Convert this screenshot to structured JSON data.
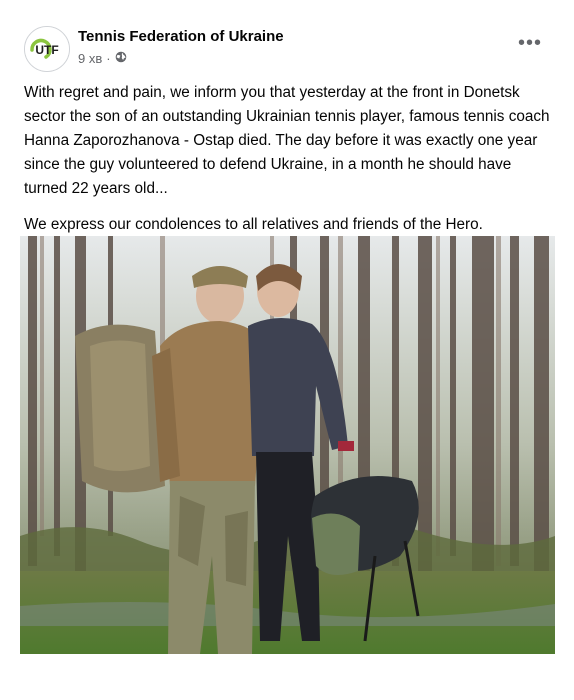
{
  "post": {
    "page_name": "Tennis Federation of Ukraine",
    "avatar_text": "UTF",
    "time": "9 хв",
    "separator": "·",
    "visibility_icon": "globe-icon",
    "more_icon": "more-options-icon",
    "more_label": "•••",
    "paragraphs": [
      "With regret and pain, we inform you that yesterday at the front in Donetsk sector the son of an outstanding Ukrainian tennis player, famous tennis coach Hanna Zaporozhanova - Ostap died. The day before it was exactly one year since the guy volunteered to defend Ukraine, in a month he should have turned 22 years old...",
      "We express our condolences to all relatives and friends of the Hero."
    ]
  },
  "colors": {
    "text": "#050505",
    "meta": "#65676b",
    "logo_green": "#8bc53f"
  }
}
